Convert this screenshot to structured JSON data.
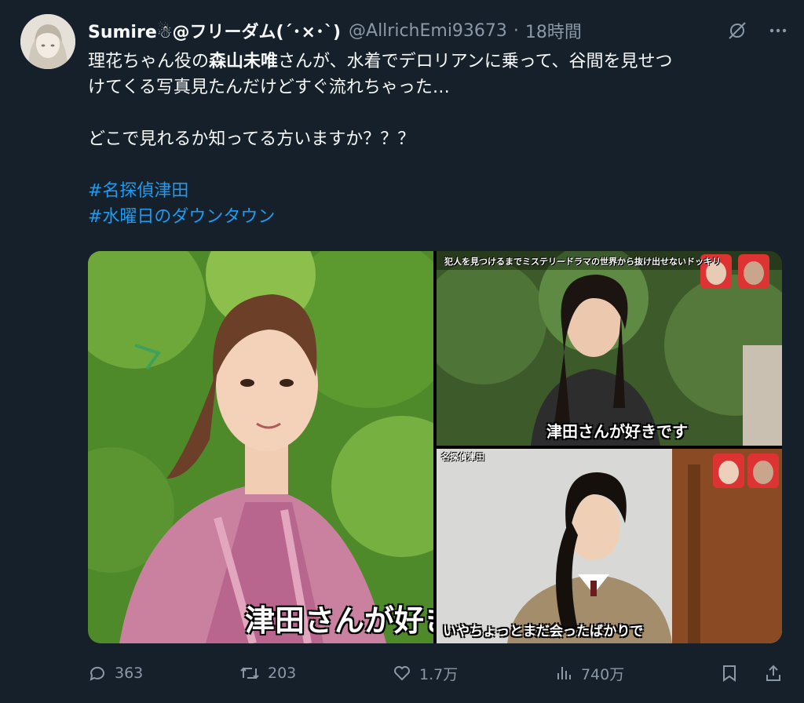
{
  "tweet": {
    "display_name": "Sumire☃@フリーダム(´･×･`)",
    "handle": "@AllrichEmi93673",
    "separator": "·",
    "time": "18時間",
    "text_line1_pre": "理花ちゃん役の",
    "text_line1_bold": "森山未唯",
    "text_line1_post": "さんが、水着でデロリアンに乗って、谷間を見せつ",
    "text_line2": "けてくる写真見たんだけどすぐ流れちゃった…",
    "text_line3": "どこで見れるか知ってる方いますか？？？",
    "hashtags": [
      "#名探偵津田",
      "#水曜日のダウンタウン"
    ]
  },
  "media": {
    "left_caption": "津田さんが好き",
    "top_right_banner": "犯人を見つけるまでミステリードラマの世界から抜け出せないドッキリ",
    "top_right_caption": "津田さんが好きです",
    "bottom_right_banner": "名探偵津田",
    "bottom_right_caption": "いやちょっとまだ会ったばかりで"
  },
  "actions": {
    "replies": "363",
    "reposts": "203",
    "likes": "1.7万",
    "views": "740万"
  },
  "icons": {
    "grok": "grok-icon",
    "more": "more-icon",
    "reply": "reply-icon",
    "repost": "repost-icon",
    "like": "like-icon",
    "views": "views-icon",
    "bookmark": "bookmark-icon",
    "share": "share-icon"
  },
  "colors": {
    "background": "#15202b",
    "text": "#f7f9f9",
    "muted": "#8b98a5",
    "link": "#1d9bf0"
  }
}
